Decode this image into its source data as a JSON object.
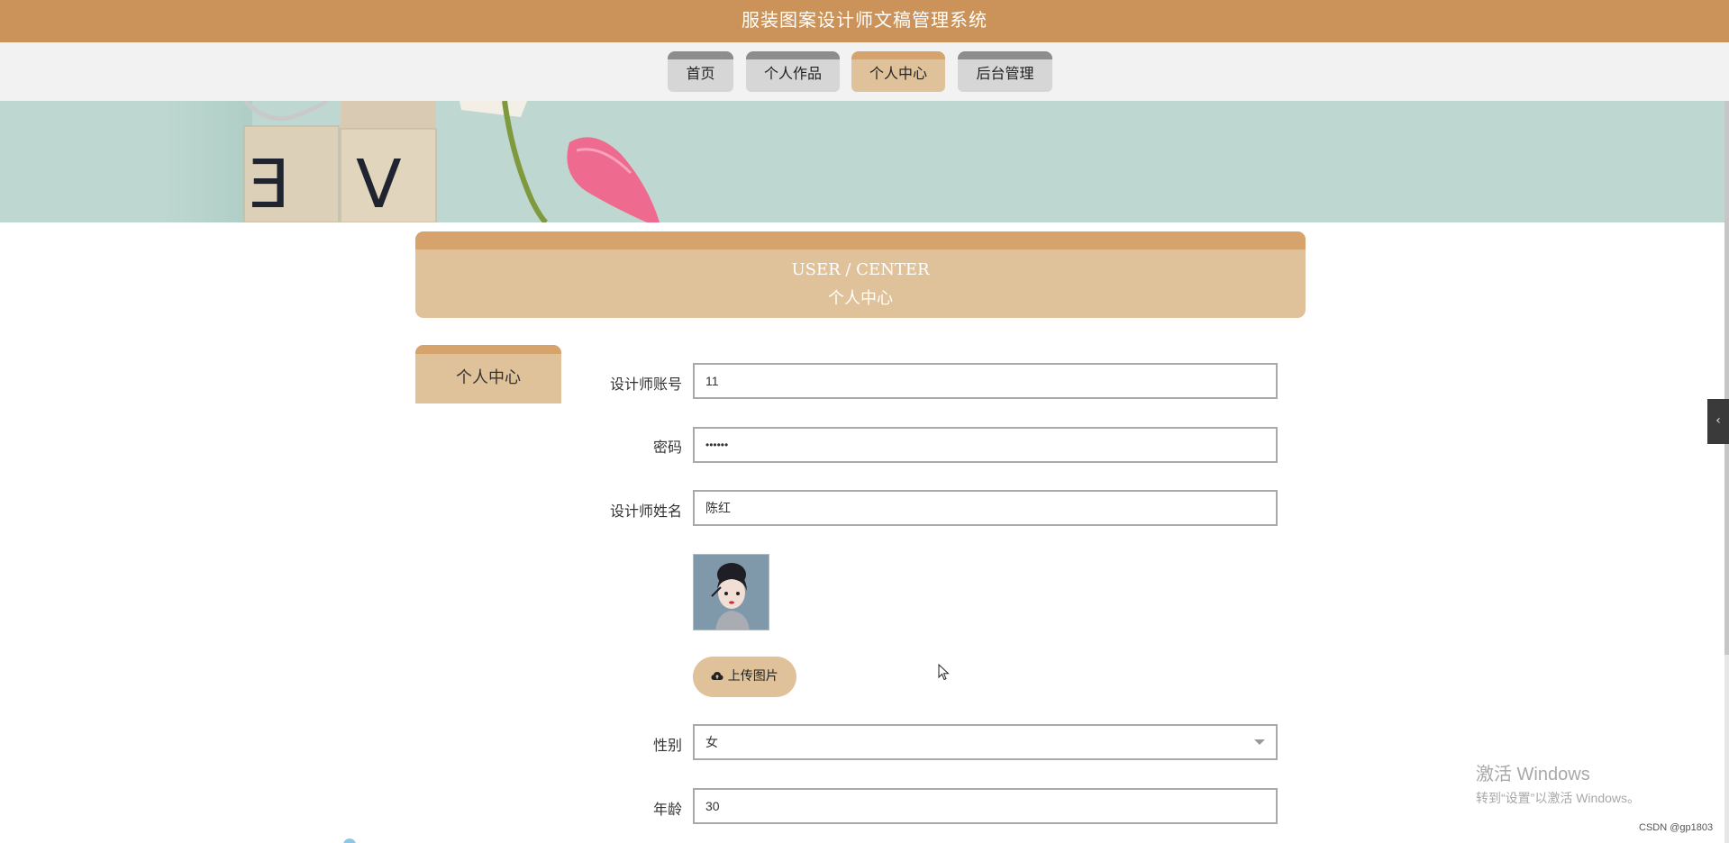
{
  "header": {
    "title": "服装图案设计师文稿管理系统"
  },
  "nav": {
    "tabs": [
      {
        "label": "首页"
      },
      {
        "label": "个人作品"
      },
      {
        "label": "个人中心"
      },
      {
        "label": "后台管理"
      }
    ],
    "active_tab": "个人中心"
  },
  "banner": {
    "tile_letters": [
      "E",
      "V"
    ]
  },
  "center_header": {
    "title_en": "USER / CENTER",
    "title_cn": "个人中心"
  },
  "sidebar": {
    "items": [
      {
        "label": "个人中心"
      }
    ]
  },
  "form": {
    "account_label": "设计师账号",
    "account_value": "11",
    "password_label": "密码",
    "password_value": "••••••",
    "name_label": "设计师姓名",
    "name_value": "陈红",
    "upload_label": "上传图片",
    "gender_label": "性别",
    "gender_value": "女",
    "age_label": "年龄",
    "age_value": "30"
  },
  "watermark": {
    "line1": "激活 Windows",
    "line2": "转到“设置”以激活 Windows。"
  },
  "credit": "CSDN @gp1803",
  "colors": {
    "top_bar": "#cb9359",
    "accent": "#e0c29a",
    "accent_dark": "#d6a36c",
    "tab_inactive": "#d6d6d6",
    "banner_bg": "#bed8d1"
  },
  "icons": [
    "cloud-upload-icon",
    "chevron-down-icon",
    "chevron-left-icon"
  ]
}
